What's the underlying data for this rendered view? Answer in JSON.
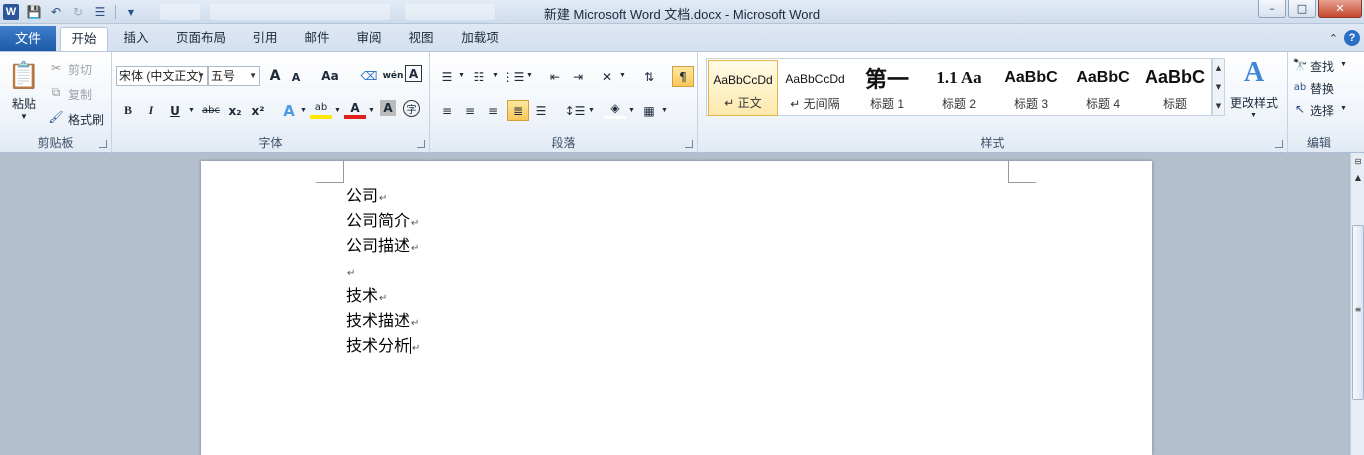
{
  "titlebar": {
    "app_icon": "W",
    "title": "新建 Microsoft Word 文档.docx - Microsoft Word",
    "qat": [
      "save-icon",
      "undo-icon",
      "redo-icon",
      "list-icon",
      "customize-icon"
    ],
    "min": "–",
    "max": "□",
    "close": "✕"
  },
  "tabs": {
    "file": "文件",
    "items": [
      "开始",
      "插入",
      "页面布局",
      "引用",
      "邮件",
      "审阅",
      "视图",
      "加载项"
    ]
  },
  "clipboard": {
    "paste": "粘贴",
    "cut": "剪切",
    "copy": "复制",
    "format_painter": "格式刷",
    "label": "剪贴板"
  },
  "font": {
    "name": "宋体 (中文正文)",
    "size": "五号",
    "grow": "A",
    "shrink": "A",
    "case": "Aa",
    "bold": "B",
    "italic": "I",
    "underline": "U",
    "strike": "abc",
    "sub": "x₂",
    "sup": "x²",
    "label": "字体"
  },
  "paragraph": {
    "label": "段落"
  },
  "styles": {
    "items": [
      {
        "sample": "AaBbCcDd",
        "name": "↵ 正文"
      },
      {
        "sample": "AaBbCcDd",
        "name": "↵ 无间隔"
      },
      {
        "sample": "第一",
        "name": "标题 1"
      },
      {
        "sample": "1.1 Aa",
        "name": "标题 2"
      },
      {
        "sample": "AaBbC",
        "name": "标题 3"
      },
      {
        "sample": "AaBbC",
        "name": "标题 4"
      },
      {
        "sample": "AaBbC",
        "name": "标题"
      }
    ],
    "change": "更改样式",
    "label": "样式"
  },
  "editing": {
    "find": "查找",
    "replace": "替换",
    "select": "选择",
    "label": "编辑"
  },
  "document": {
    "lines": [
      "公司",
      "公司简介",
      "公司描述",
      "",
      "技术",
      "技术描述",
      "技术分析"
    ]
  }
}
